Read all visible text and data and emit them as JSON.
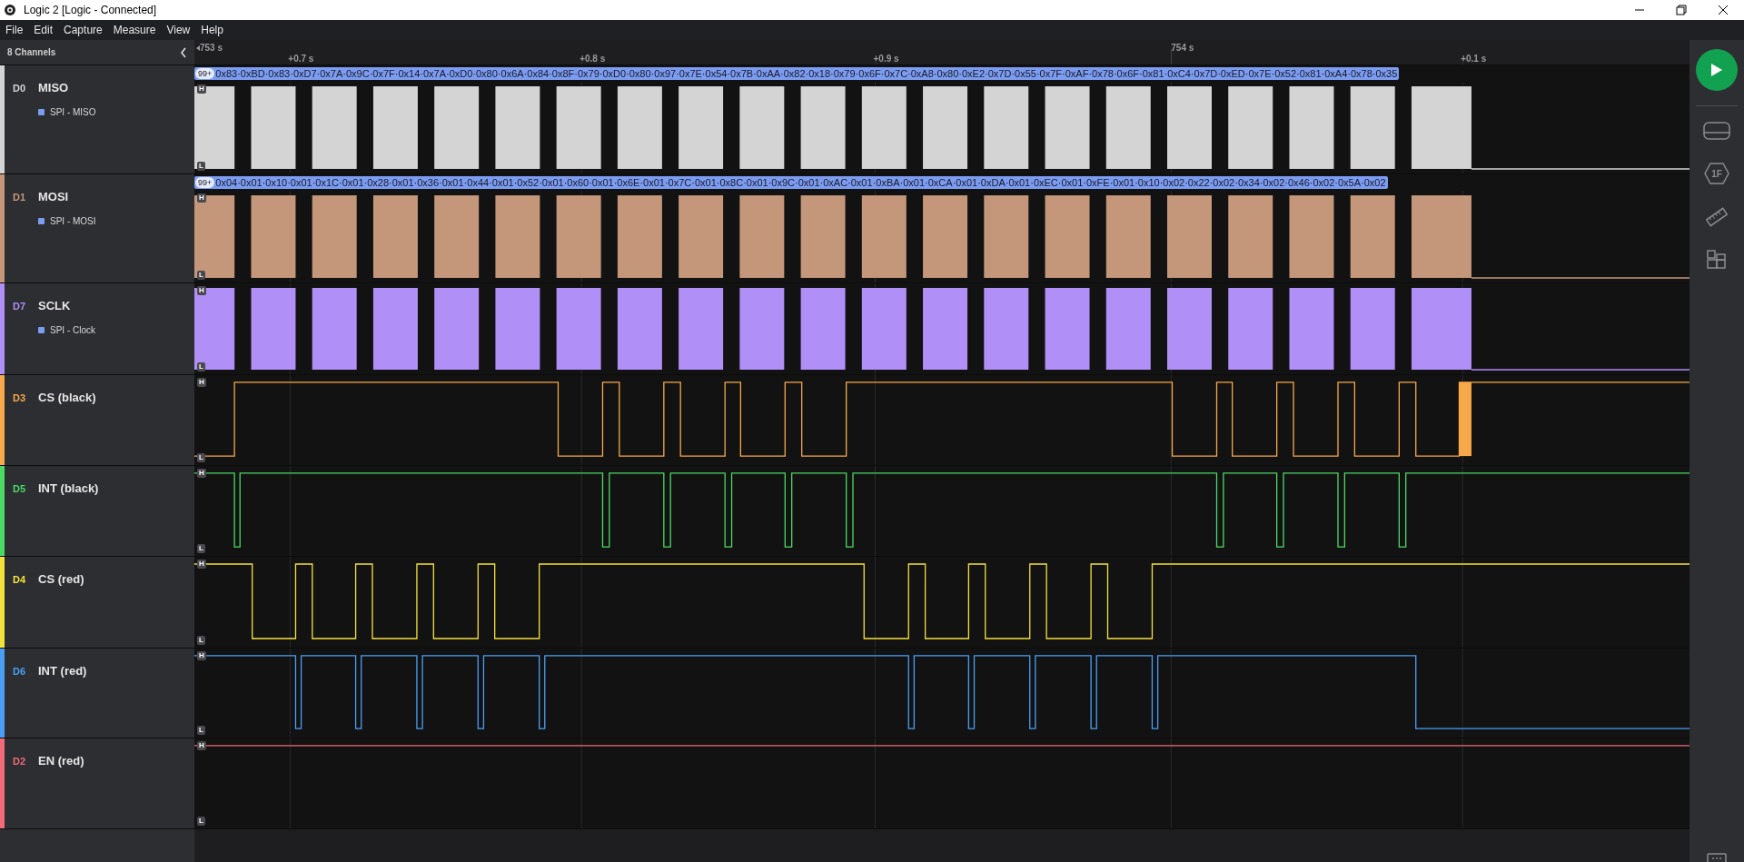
{
  "window": {
    "title": "Logic 2 [Logic - Connected]"
  },
  "menu": [
    "File",
    "Edit",
    "Capture",
    "Measure",
    "View",
    "Help"
  ],
  "sidebar": {
    "title": "8 Channels"
  },
  "timeline": {
    "start": "753 s",
    "ticks": [
      {
        "label": "+0.7 s",
        "major": false
      },
      {
        "label": "+0.8 s",
        "major": false
      },
      {
        "label": "+0.9 s",
        "major": false
      },
      {
        "label": "754 s",
        "major": true
      },
      {
        "label": "+0.1 s",
        "major": false
      }
    ]
  },
  "channels": [
    {
      "id": "D0",
      "name": "MISO",
      "color": "#d4d4d4",
      "kind": "decoded",
      "analyzer": "SPI - MISO",
      "badge": "99+",
      "decoded": "0x83·0xBD·0x83·0xD7·0x7A·0x9C·0x7F·0x14·0x7A·0xD0·0x80·0x6A·0x84·0x8F·0x79·0xD0·0x80·0x97·0x7E·0x54·0x7B·0xAA·0x82·0x18·0x79·0x6F·0x7C·0xA8·0x80·0xE2·0x7D·0x55·0x7F·0xAF·0x78·0x6F·0x81·0xC4·0x7D·0xED·0x7E·0x52·0x81·0xA4·0x78·0x35",
      "high": "H",
      "low": "L"
    },
    {
      "id": "D1",
      "name": "MOSI",
      "color": "#c4977b",
      "kind": "decoded",
      "analyzer": "SPI - MOSI",
      "badge": "99+",
      "decoded": "0x04·0x01·0x10·0x01·0x1C·0x01·0x28·0x01·0x36·0x01·0x44·0x01·0x52·0x01·0x60·0x01·0x6E·0x01·0x7C·0x01·0x8C·0x01·0x9C·0x01·0xAC·0x01·0xBA·0x01·0xCA·0x01·0xDA·0x01·0xEC·0x01·0xFE·0x01·0x10·0x02·0x22·0x02·0x34·0x02·0x46·0x02·0x5A·0x02",
      "high": "H",
      "low": "L"
    },
    {
      "id": "D7",
      "name": "SCLK",
      "color": "#b08ff7",
      "kind": "clock",
      "analyzer": "SPI - Clock",
      "high": "H",
      "low": "L"
    },
    {
      "id": "D3",
      "name": "CS (black)",
      "color": "#f7a84a",
      "kind": "line",
      "high": "H",
      "low": "L"
    },
    {
      "id": "D5",
      "name": "INT (black)",
      "color": "#4cd964",
      "kind": "line",
      "high": "H",
      "low": "L"
    },
    {
      "id": "D4",
      "name": "CS (red)",
      "color": "#f4e23c",
      "kind": "line",
      "high": "H",
      "low": "L"
    },
    {
      "id": "D6",
      "name": "INT (red)",
      "color": "#4a9ff5",
      "kind": "line",
      "high": "H",
      "low": "L"
    },
    {
      "id": "D2",
      "name": "EN (red)",
      "color": "#f06a7a",
      "kind": "line",
      "high": "H",
      "low": "L"
    }
  ],
  "toolbar": {
    "analyzers_icon_label": "1F"
  }
}
